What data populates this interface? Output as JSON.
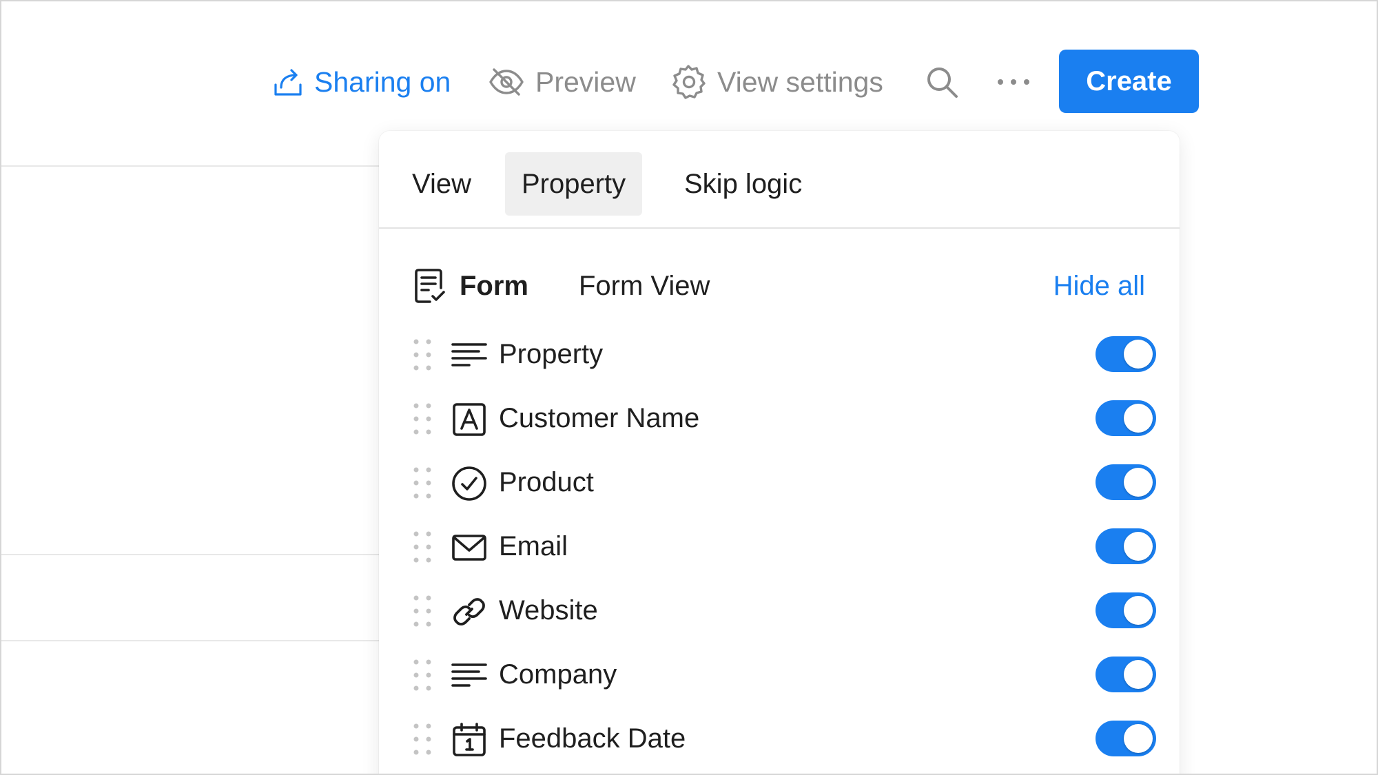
{
  "toolbar": {
    "sharing_label": "Sharing on",
    "preview_label": "Preview",
    "view_settings_label": "View settings",
    "create_label": "Create"
  },
  "panel": {
    "tabs": [
      {
        "label": "View",
        "active": false
      },
      {
        "label": "Property",
        "active": true
      },
      {
        "label": "Skip logic",
        "active": false
      }
    ],
    "form": {
      "type_label": "Form",
      "name": "Form View",
      "hide_all_label": "Hide all"
    },
    "properties": [
      {
        "label": "Property",
        "icon": "text-lines-icon",
        "visible": true
      },
      {
        "label": "Customer Name",
        "icon": "title-a-icon",
        "visible": true
      },
      {
        "label": "Product",
        "icon": "check-circle-icon",
        "visible": true
      },
      {
        "label": "Email",
        "icon": "envelope-icon",
        "visible": true
      },
      {
        "label": "Website",
        "icon": "link-icon",
        "visible": true
      },
      {
        "label": "Company",
        "icon": "text-lines-icon",
        "visible": true
      },
      {
        "label": "Feedback Date",
        "icon": "calendar-icon",
        "visible": true
      }
    ]
  },
  "colors": {
    "accent": "#1a7ff0",
    "muted": "#8c8c8c",
    "text": "#1f1f1f"
  }
}
